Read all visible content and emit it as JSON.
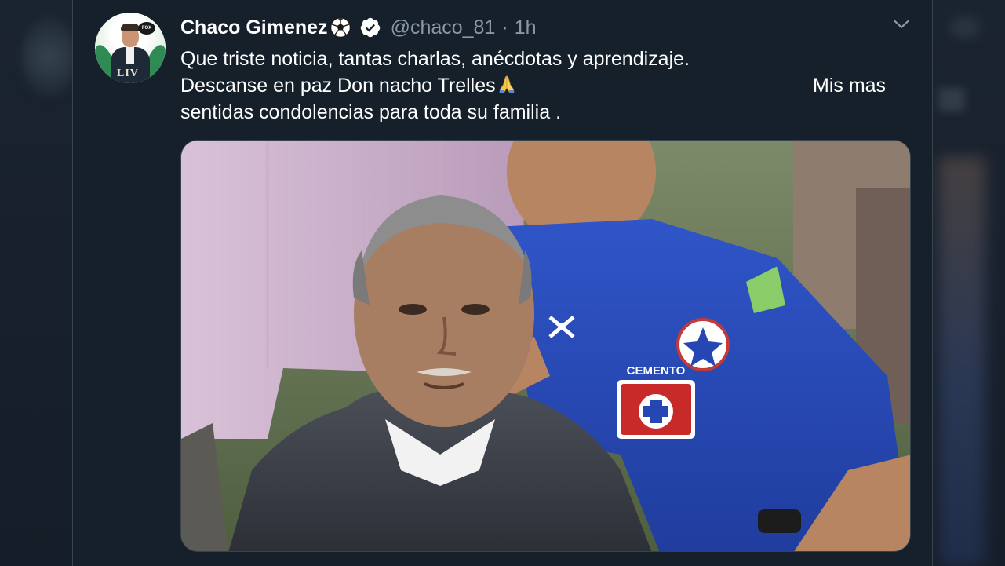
{
  "tweet": {
    "author_name": "Chaco Gimenez",
    "handle": "@chaco_81",
    "separator": "·",
    "time": "1h",
    "text_lines": [
      "Que triste noticia, tantas charlas, anécdotas y aprendizaje.",
      "Descanse en paz Don nacho Trelles",
      "Mis mas",
      "sentidas condolencias para toda su familia ."
    ],
    "avatar_badge": "FOX",
    "avatar_caption": "LIV",
    "icons": [
      "soccer-ball-icon",
      "verified-badge-icon",
      "praying-hands-icon",
      "chevron-down-icon"
    ]
  },
  "photo": {
    "jersey_text": "CEMENTO"
  },
  "colors": {
    "background": "#15202b",
    "text_primary": "#ffffff",
    "text_secondary": "#8899a6",
    "border": "#38444d"
  }
}
